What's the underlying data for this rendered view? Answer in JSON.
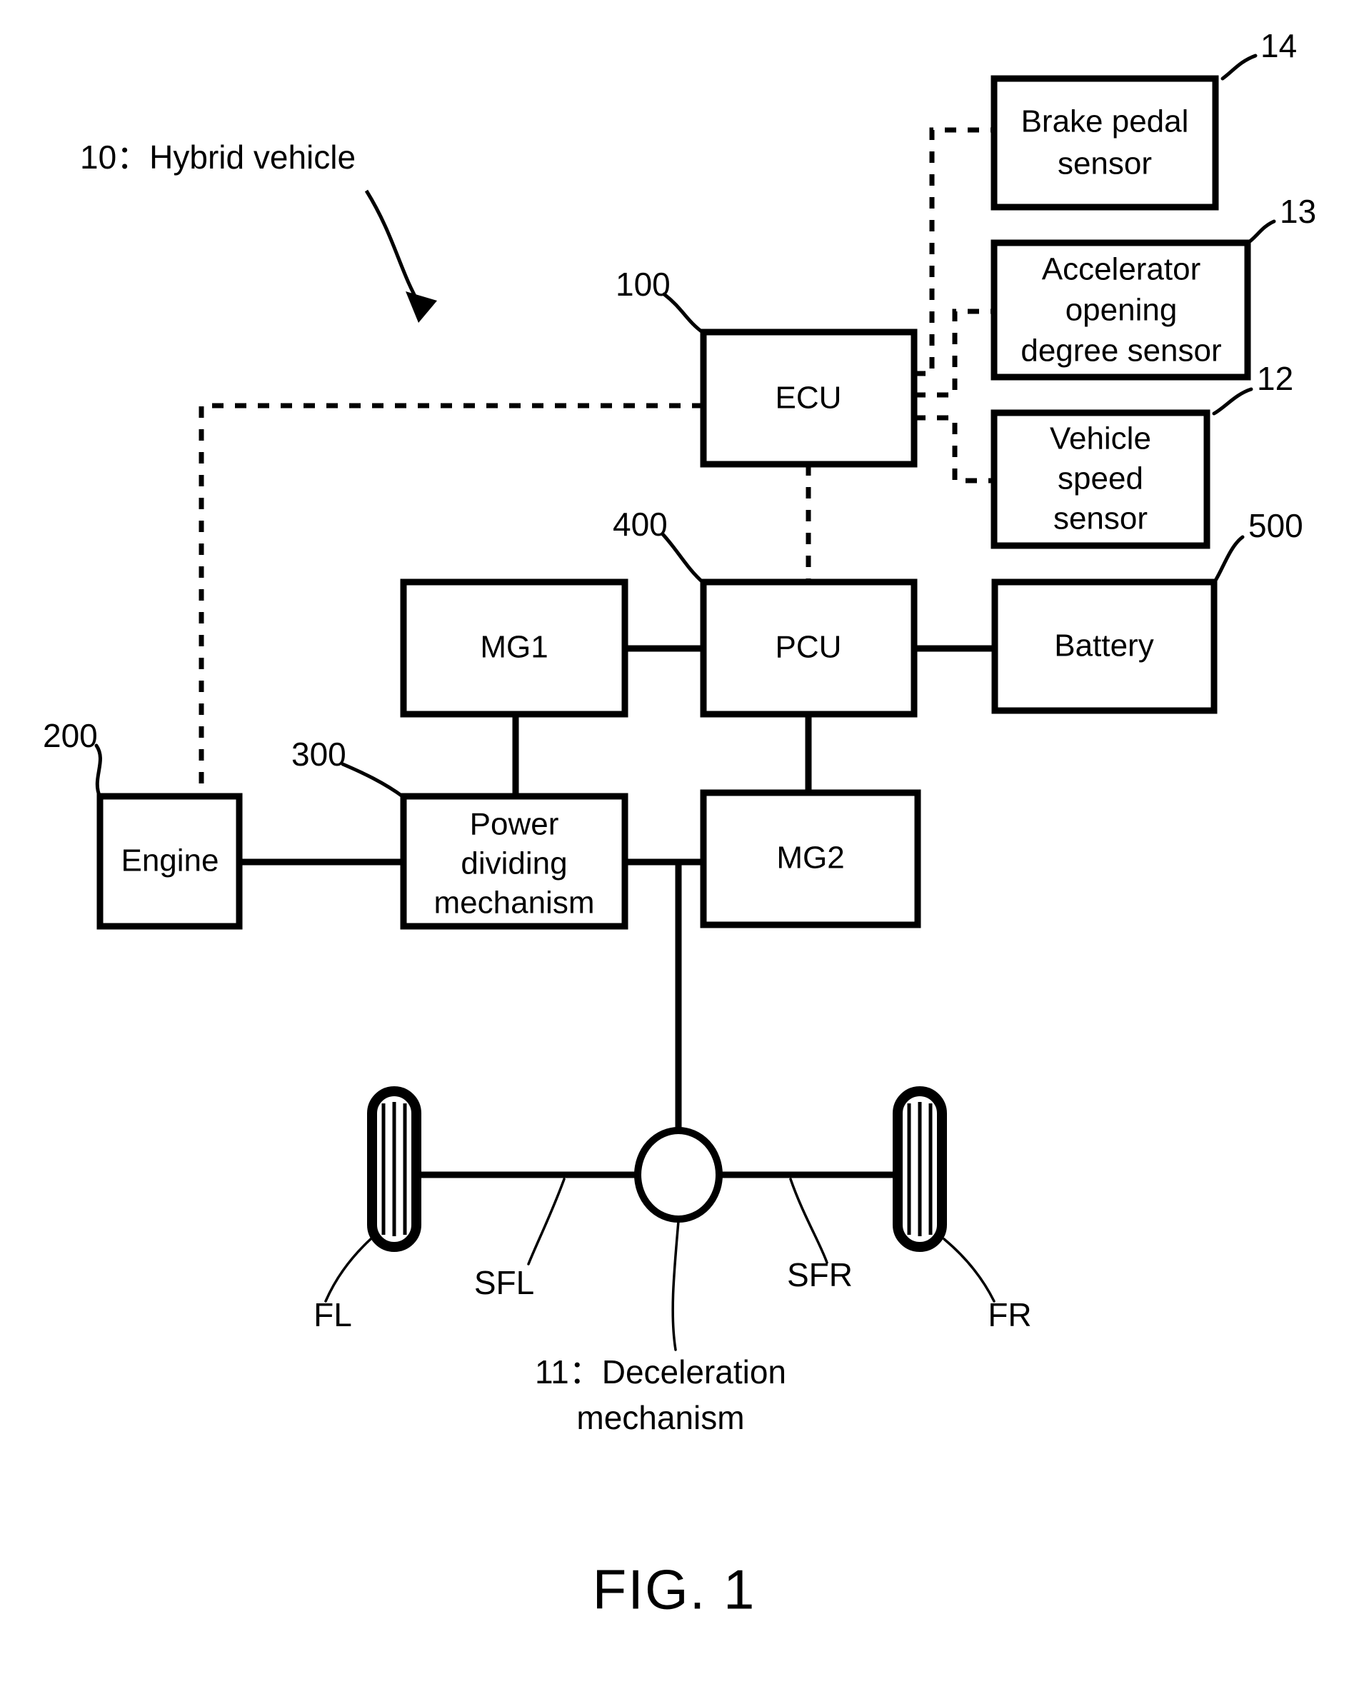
{
  "figure": {
    "caption": "FIG. 1",
    "title_callout": {
      "ref": "10",
      "separator": "：",
      "text": "10：Hybrid vehicle"
    }
  },
  "nodes": {
    "brake_pedal_sensor": {
      "label_line1": "Brake pedal",
      "label_line2": "sensor",
      "ref": "14"
    },
    "accelerator_sensor": {
      "label_line1": "Accelerator",
      "label_line2": "opening",
      "label_line3": "degree sensor",
      "ref": "13"
    },
    "vehicle_speed_sensor": {
      "label_line1": "Vehicle",
      "label_line2": "speed",
      "label_line3": "sensor",
      "ref": "12"
    },
    "ecu": {
      "label": "ECU",
      "ref": "100"
    },
    "mg1": {
      "label": "MG1",
      "ref": ""
    },
    "pcu": {
      "label": "PCU",
      "ref": "400"
    },
    "battery": {
      "label": "Battery",
      "ref": "500"
    },
    "engine": {
      "label": "Engine",
      "ref": "200"
    },
    "power_dividing_mechanism": {
      "label_line1": "Power",
      "label_line2": "dividing",
      "label_line3": "mechanism",
      "ref": "300"
    },
    "mg2": {
      "label": "MG2",
      "ref": ""
    }
  },
  "drivetrain": {
    "wheel_front_left": "FL",
    "wheel_front_right": "FR",
    "shaft_front_left": "SFL",
    "shaft_front_right": "SFR",
    "deceleration_mechanism": {
      "ref": "11",
      "text_line1": "11：Deceleration",
      "text_line2": "mechanism"
    }
  },
  "colors": {
    "ink": "#000000",
    "paper": "#ffffff"
  }
}
